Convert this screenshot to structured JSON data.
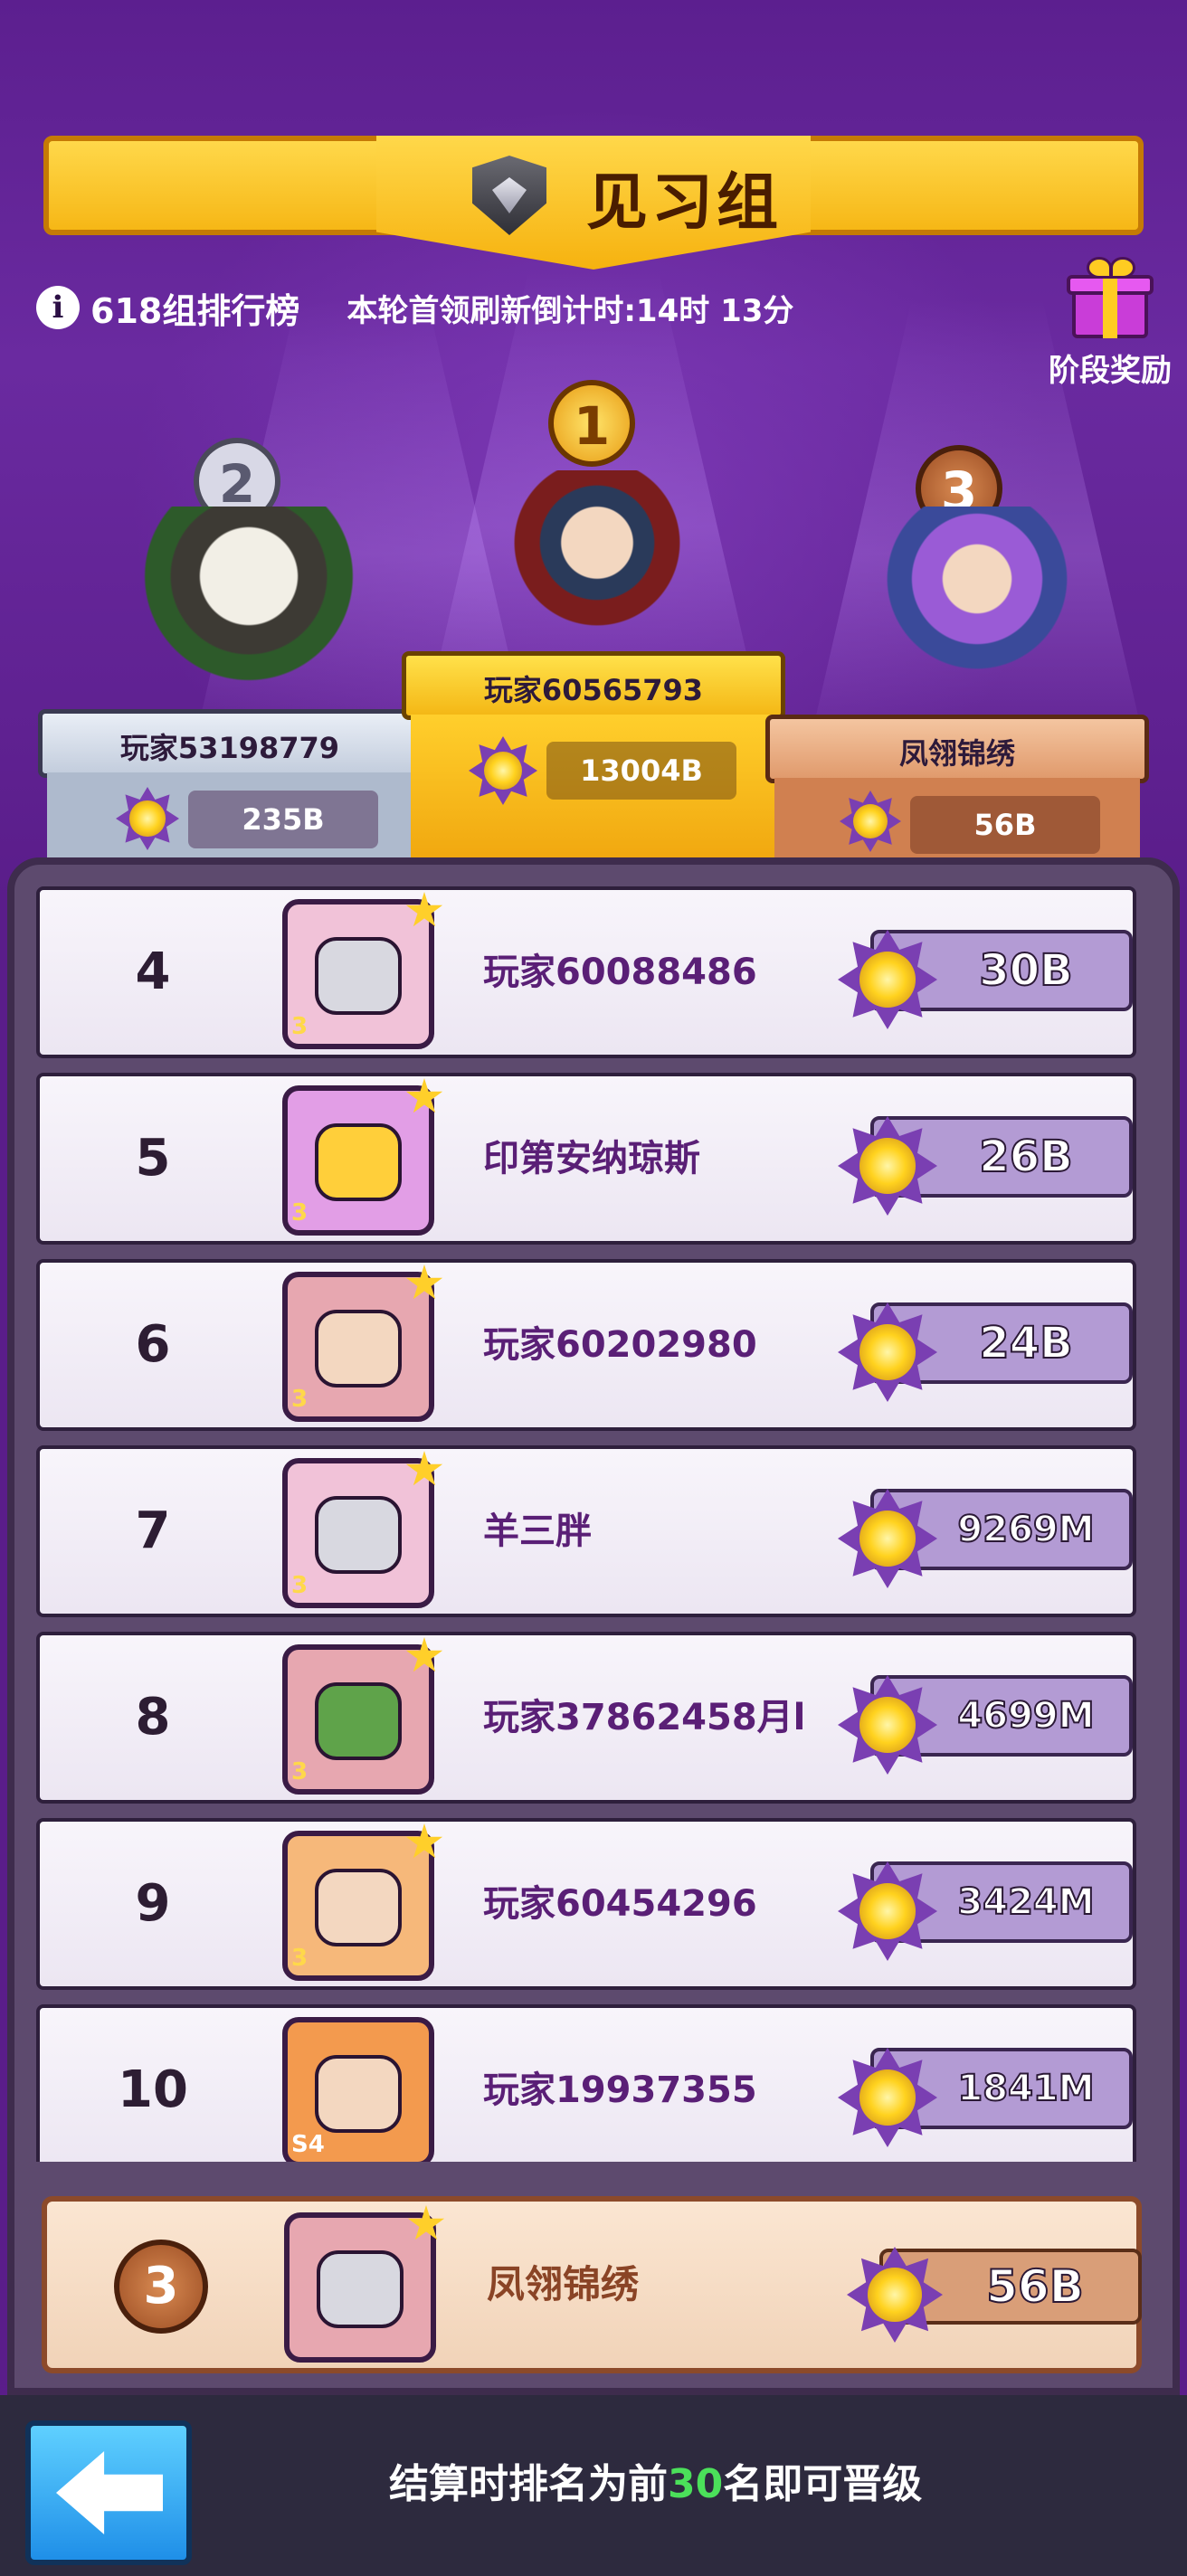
{
  "header": {
    "title": "见习组",
    "group_label": "618组排行榜",
    "countdown": "本轮首领刷新倒计时:14时 13分",
    "stage_reward_label": "阶段奖励"
  },
  "podium": [
    {
      "rank": "2",
      "name": "玩家53198779",
      "score": "235B"
    },
    {
      "rank": "1",
      "name": "玩家60565793",
      "score": "13004B"
    },
    {
      "rank": "3",
      "name": "凤翎锦绣",
      "score": "56B"
    }
  ],
  "leaderboard": [
    {
      "rank": "4",
      "name": "玩家60088486",
      "score": "30B",
      "avatar_color": "#f1c2d8",
      "level": "3"
    },
    {
      "rank": "5",
      "name": "印第安纳琼斯",
      "score": "26B",
      "avatar_color": "#e29ee6",
      "level": "3"
    },
    {
      "rank": "6",
      "name": "玩家60202980",
      "score": "24B",
      "avatar_color": "#e7a7b0",
      "level": "3"
    },
    {
      "rank": "7",
      "name": "羊三胖",
      "score": "9269M",
      "avatar_color": "#f1c2d8",
      "level": "3"
    },
    {
      "rank": "8",
      "name": "玩家37862458月l",
      "score": "4699M",
      "avatar_color": "#e7a7b0",
      "level": "3"
    },
    {
      "rank": "9",
      "name": "玩家60454296",
      "score": "3424M",
      "avatar_color": "#f6b87a",
      "level": "3"
    },
    {
      "rank": "10",
      "name": "玩家19937355",
      "score": "1841M",
      "avatar_color": "#f39a4e",
      "level": "S4"
    }
  ],
  "me": {
    "rank": "3",
    "name": "凤翎锦绣",
    "score": "56B"
  },
  "footer": {
    "hint_prefix": "结算时排名为前",
    "hint_number": "30",
    "hint_suffix": "名即可晋级"
  },
  "colors": {
    "background": "#5a1d8a",
    "banner_gold": "#f6b716",
    "accent_green": "#4be05a",
    "back_button": "#1f8fe8"
  }
}
